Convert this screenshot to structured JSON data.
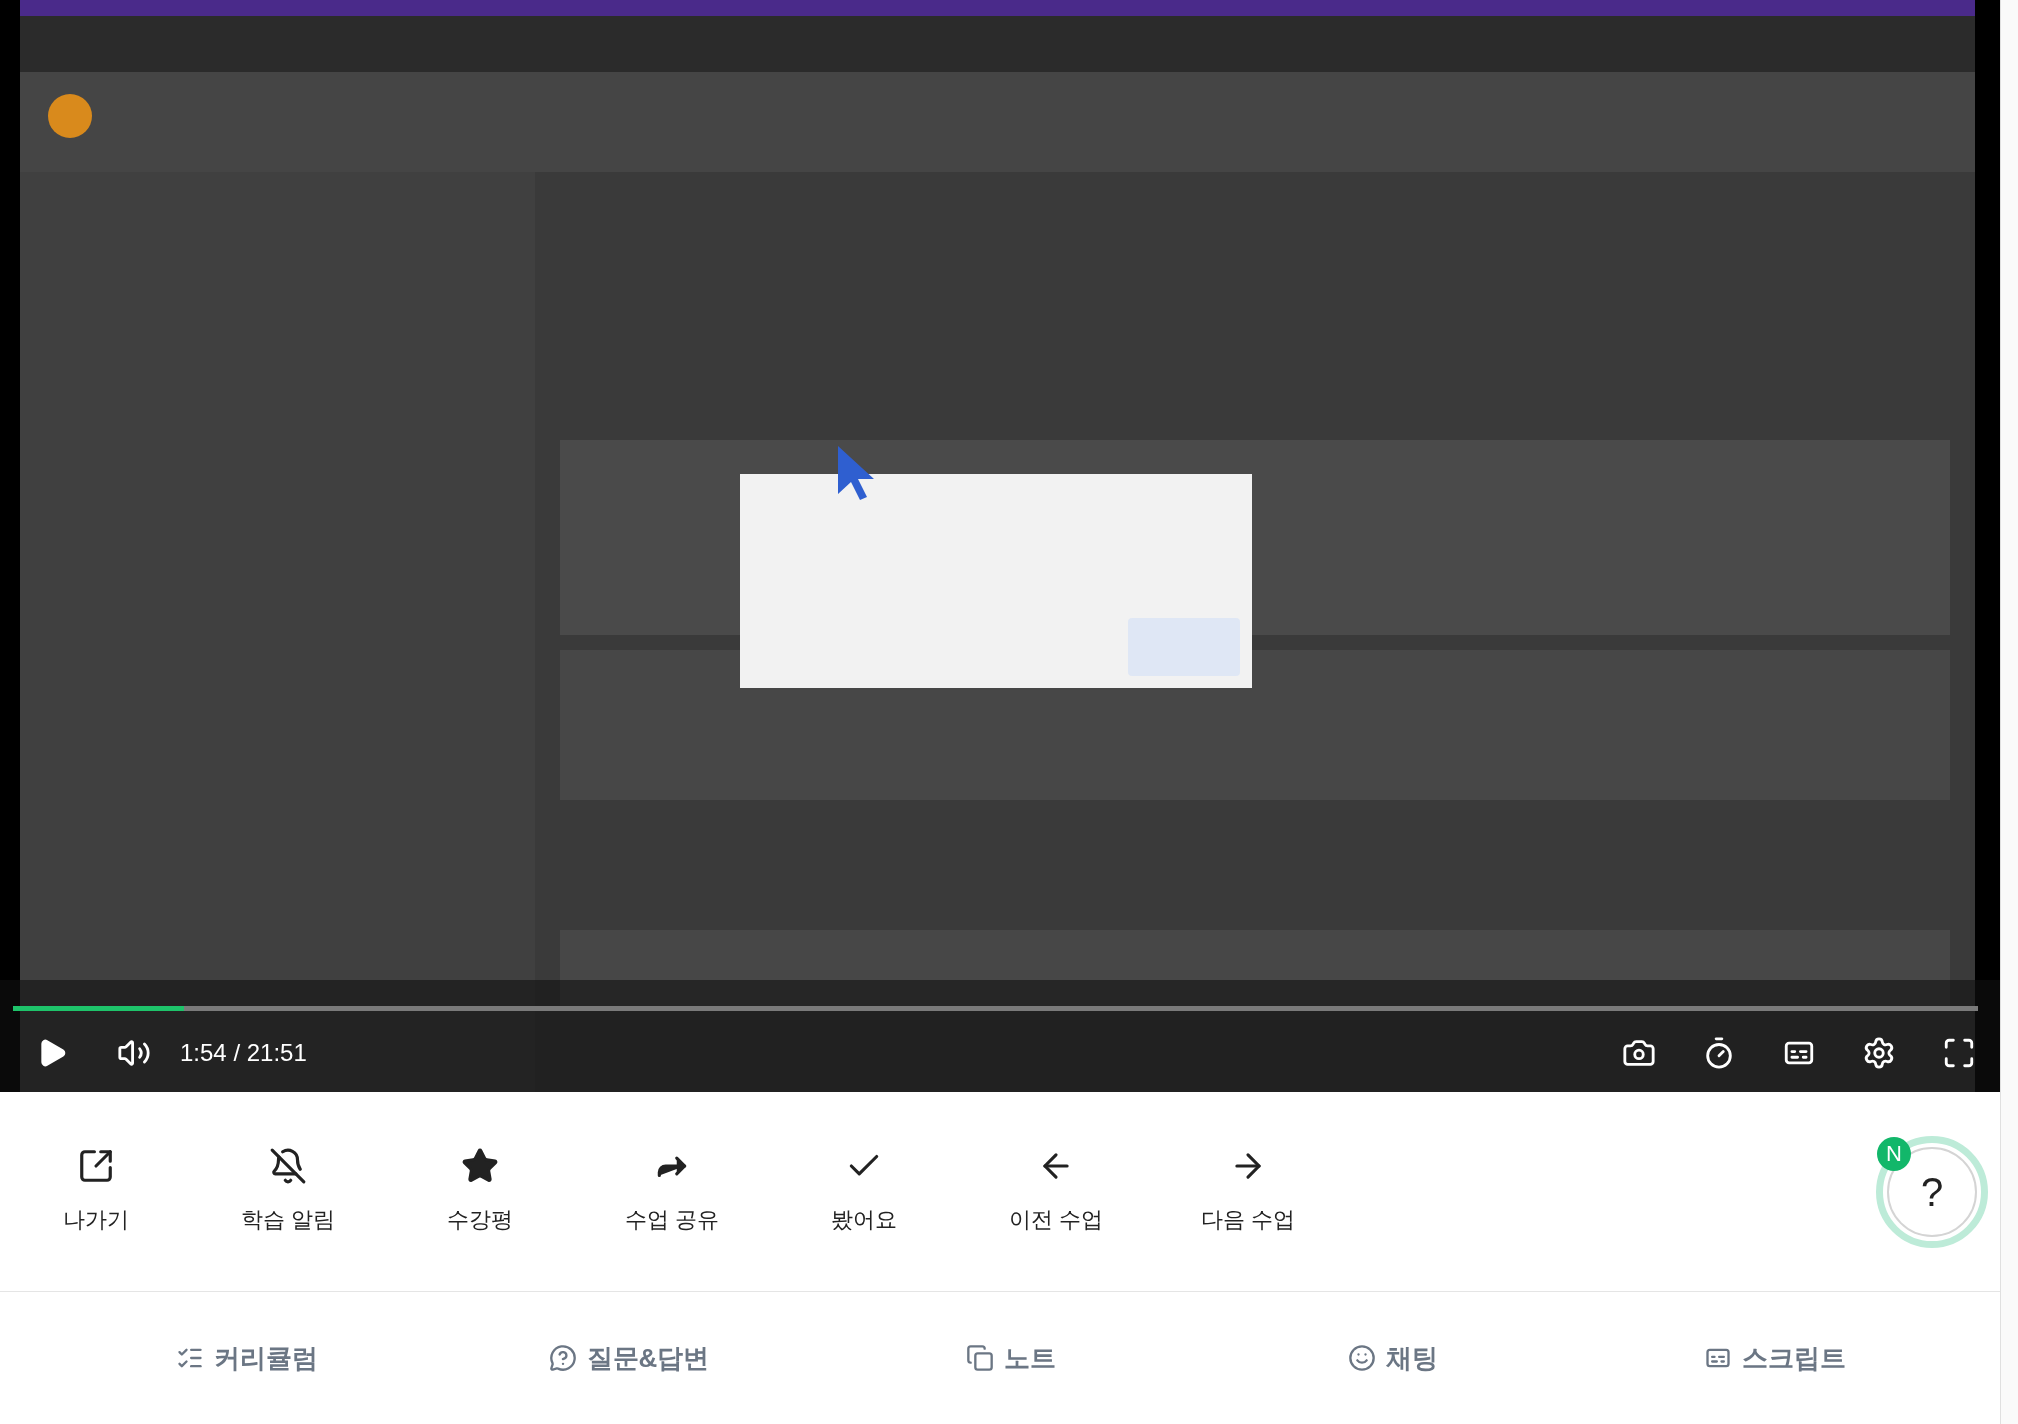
{
  "video": {
    "kind": "picture",
    "time": "1:54 / 21:51",
    "level": 0.087
  },
  "actions": [
    {
      "label": "나가기"
    },
    {
      "label": "학습 알림"
    },
    {
      "label": "수강평"
    },
    {
      "label": "수업 공유"
    },
    {
      "label": "봤어요"
    },
    {
      "label": "이전 수업"
    },
    {
      "label": "다음 수업"
    }
  ],
  "help": {
    "symbol": "?",
    "badge": "N"
  },
  "tabs": [
    {
      "label": "커리큘럼"
    },
    {
      "label": "질문&답변"
    },
    {
      "label": "노트"
    },
    {
      "label": "채팅"
    },
    {
      "label": "스크립트"
    }
  ]
}
